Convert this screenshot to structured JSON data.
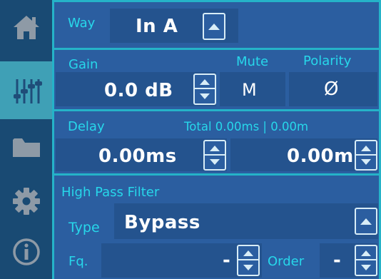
{
  "nav": [
    {
      "icon": "home-icon",
      "active": false
    },
    {
      "icon": "sliders-icon",
      "active": true
    },
    {
      "icon": "folder-icon",
      "active": false
    },
    {
      "icon": "gear-icon",
      "active": false
    },
    {
      "icon": "info-icon",
      "active": false
    }
  ],
  "way": {
    "label": "Way",
    "value": "In A"
  },
  "gain": {
    "label": "Gain",
    "value": "0.0 dB"
  },
  "mute": {
    "label": "Mute",
    "value": "M"
  },
  "polarity": {
    "label": "Polarity",
    "value": "Ø"
  },
  "delay": {
    "label": "Delay",
    "total": "Total 0.00ms | 0.00m",
    "ms_value": "0.00ms",
    "m_value": "0.00m"
  },
  "hpf": {
    "title": "High Pass Filter",
    "type_label": "Type",
    "type_value": "Bypass",
    "fq_label": "Fq.",
    "fq_value": "-",
    "order_label": "Order",
    "order_value": "-"
  },
  "colors": {
    "background": "#2b5ea0",
    "accent": "#27d7ea",
    "active_nav": "#3fa0b6"
  }
}
